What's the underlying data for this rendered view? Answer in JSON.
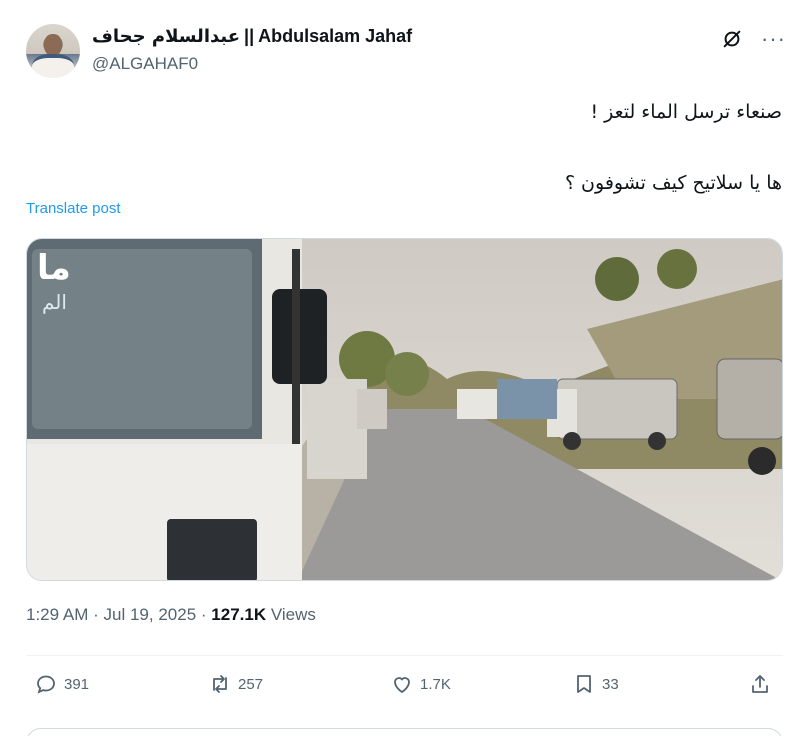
{
  "author": {
    "name_latin": "Abdulsalam Jahaf",
    "separator": "||",
    "name_arabic": "عبدالسلام جحاف",
    "handle": "@ALGAHAF0"
  },
  "header_icons": [
    "grok-icon",
    "more-icon"
  ],
  "post": {
    "line1": "صنعاء ترسل الماء لتعز !",
    "line2": "ها يا سلاتيح كيف تشوفون ؟",
    "translate_label": "Translate post"
  },
  "media": {
    "alt": "Water tanker trucks lined along a road",
    "visible_text": [
      "ما",
      "الم"
    ]
  },
  "meta": {
    "time": "1:29 AM",
    "date": "Jul 19, 2025",
    "views_count": "127.1K",
    "views_label": "Views"
  },
  "actions": {
    "replies": "391",
    "reposts": "257",
    "likes": "1.7K",
    "bookmarks": "33"
  },
  "colors": {
    "accent": "#1d9bf0",
    "secondary_text": "#536471",
    "border": "#cfd9de"
  }
}
